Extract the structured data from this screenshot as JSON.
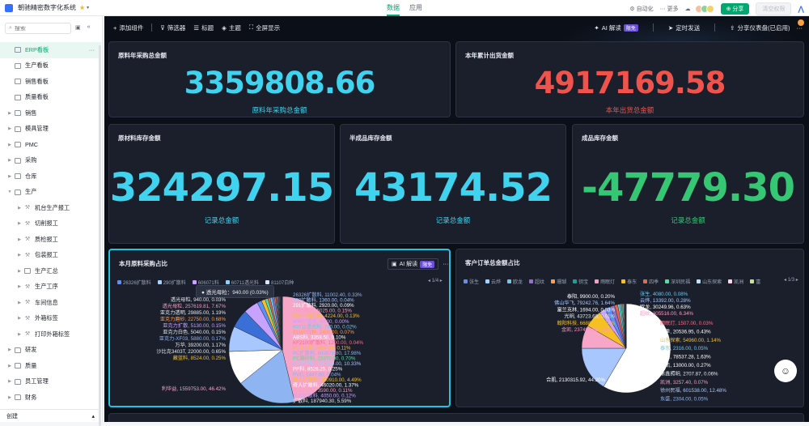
{
  "app": {
    "title": "朝驰精密数字化系统",
    "star": "★",
    "caret": "▾"
  },
  "topnav": {
    "tabs": [
      {
        "label": "数据",
        "active": true
      },
      {
        "label": "应用",
        "active": false
      }
    ]
  },
  "topright": {
    "automation": "自动化",
    "more": "更多",
    "share": "分享",
    "publish": "清空权限"
  },
  "sidebar": {
    "search_placeholder": "搜索",
    "items": [
      {
        "label": "ERP看板",
        "level": 0,
        "type": "board",
        "active": true,
        "arrow": ""
      },
      {
        "label": "生产看板",
        "level": 0,
        "type": "board",
        "arrow": ""
      },
      {
        "label": "销售看板",
        "level": 0,
        "type": "board",
        "arrow": ""
      },
      {
        "label": "质量看板",
        "level": 0,
        "type": "board",
        "arrow": ""
      },
      {
        "label": "销售",
        "level": 0,
        "type": "folder",
        "arrow": "▶"
      },
      {
        "label": "模具管理",
        "level": 0,
        "type": "folder",
        "arrow": "▶"
      },
      {
        "label": "PMC",
        "level": 0,
        "type": "folder",
        "arrow": "▶"
      },
      {
        "label": "采购",
        "level": 0,
        "type": "folder",
        "arrow": "▶"
      },
      {
        "label": "仓库",
        "level": 0,
        "type": "folder",
        "arrow": "▶"
      },
      {
        "label": "生产",
        "level": 0,
        "type": "folder",
        "arrow": "▼"
      },
      {
        "label": "机台生产报工",
        "level": 1,
        "type": "tool",
        "arrow": "▶"
      },
      {
        "label": "切削报工",
        "level": 1,
        "type": "tool",
        "arrow": "▶"
      },
      {
        "label": "质检报工",
        "level": 1,
        "type": "tool",
        "arrow": "▶"
      },
      {
        "label": "包装报工",
        "level": 1,
        "type": "tool",
        "arrow": "▶"
      },
      {
        "label": "生产汇总",
        "level": 1,
        "type": "board",
        "arrow": "▶"
      },
      {
        "label": "生产工序",
        "level": 1,
        "type": "tool",
        "arrow": "▶"
      },
      {
        "label": "车间信息",
        "level": 1,
        "type": "tool",
        "arrow": "▶"
      },
      {
        "label": "外箱标签",
        "level": 1,
        "type": "tool",
        "arrow": "▶"
      },
      {
        "label": "打印外箱标签",
        "level": 1,
        "type": "tool",
        "arrow": "▶"
      },
      {
        "label": "研发",
        "level": 0,
        "type": "folder",
        "arrow": "▶"
      },
      {
        "label": "质量",
        "level": 0,
        "type": "folder",
        "arrow": "▶"
      },
      {
        "label": "员工管理",
        "level": 0,
        "type": "folder",
        "arrow": "▶"
      },
      {
        "label": "财务",
        "level": 0,
        "type": "folder",
        "arrow": "▶"
      }
    ],
    "create_label": "创建"
  },
  "toolbar": {
    "add_component": "添加组件",
    "filter": "筛选器",
    "title": "标题",
    "theme": "主题",
    "fullscreen": "全屏显示",
    "ai_label": "AI 解读",
    "ai_badge": "限免",
    "schedule": "定时发送",
    "share_dashboard": "分享仪表盘(已启用)"
  },
  "cards": {
    "purchase_total": {
      "title": "原料年采购总金额",
      "value": "3359808.66",
      "sub": "原料年采购总金额",
      "color": "#3fd3ef"
    },
    "shipment_total": {
      "title": "本年累计出货金额",
      "value": "4917169.58",
      "sub": "本年出货总金额",
      "color": "#f0534b"
    },
    "raw_inventory": {
      "title": "原材料库存金额",
      "value": "324297.15",
      "sub": "记录总金额",
      "color": "#3fd3ef"
    },
    "semi_inventory": {
      "title": "半成品库存金额",
      "value": "43174.52",
      "sub": "记录总金额",
      "color": "#3fd3ef"
    },
    "finished_inventory": {
      "title": "成品库存金额",
      "value": "-47779.30",
      "sub": "记录总金额",
      "color": "#36c774"
    }
  },
  "pie_left": {
    "title": "本月原料采购占比",
    "ai_label": "AI 解读",
    "ai_badge": "限免",
    "more": "···",
    "legend": [
      "26326扩散料",
      "290扩散料",
      "606071料",
      "60711透光料",
      "81107白种"
    ],
    "legend_colors": [
      "#5b8ff9",
      "#a0d3ff",
      "#c8a2ff",
      "#8fd0ff",
      "#d6e6ff"
    ],
    "pager": "1/4",
    "tooltip": "透光母粒：940.00 (0.03%)",
    "labels": [
      "透光母粒, 940.00, 0.03%",
      "透光母粒, 257619.81, 7.67%",
      "亚克力透明, 29885.00, 1.19%",
      "亚克力磨砂, 22750.00, 0.68%",
      "亚克力扩散, 5130.00, 0.15%",
      "亚克力白色, 5040.00, 0.15%",
      "亚克力-XF03, 5880.00, 0.17%",
      "万华, 39200.00, 1.17%",
      "沙比克3403T, 22000.00, 0.65%",
      "藏蓝料, 8524.00, 0.25%",
      "利华益, 1559753.00, 46.42%",
      "26326扩散料, 11002.40, 0.33%",
      "290扩散料, 1360.00, 0.04%",
      "291扩散料, 2920.00, 0.09%",
      "2980透光, 5025.00, 0.15%",
      "60607透光料, 4224.00, 0.13%",
      "60607透光, 84.00, 0.00%",
      "60711透光料, 730.00, 0.02%",
      "81107白种, 2400.00, 0.07%",
      "ABS料, 3358.50, 0.10%",
      "KF2100扩散料, 1200.00, 0.04%",
      "PCTG 料, 3600.00, 0.11%",
      "PC扩散料, 603978.80, 17.98%",
      "PC磨砂料, 23370.00, 0.70%",
      "PC透明料, 347150.00, 10.33%",
      "PP料, 8526.25, 0.25%",
      "PVC, 1447.60, 0.04%",
      "奇人扩散料, 150910.00, 4.49%",
      "奇人扩散料, 46020.00, 1.37%",
      "奥合PC料, 3590.00, 0.11%",
      "奥合扩散料, 4050.00, 0.12%",
      "扩散料, 187940.30, 5.59%"
    ],
    "chart_data": {
      "type": "pie",
      "title": "本月原料采购占比",
      "slices": [
        {
          "label": "利华益",
          "value": 1559753.0
        },
        {
          "label": "PC扩散料",
          "value": 603978.8
        },
        {
          "label": "PC透明料",
          "value": 347150.0
        },
        {
          "label": "透光母粒",
          "value": 257619.81
        },
        {
          "label": "扩散料",
          "value": 187940.3
        },
        {
          "label": "奇人扩散料",
          "value": 150910.0
        },
        {
          "label": "奇人扩散料",
          "value": 46020.0
        },
        {
          "label": "万华",
          "value": 39200.0
        },
        {
          "label": "亚克力透明",
          "value": 29885.0
        },
        {
          "label": "PC磨砂料",
          "value": 23370.0
        },
        {
          "label": "亚克力磨砂",
          "value": 22750.0
        },
        {
          "label": "沙比克3403T",
          "value": 22000.0
        },
        {
          "label": "26326扩散料",
          "value": 11002.4
        },
        {
          "label": "PP料",
          "value": 8526.25
        },
        {
          "label": "藏蓝料",
          "value": 8524.0
        },
        {
          "label": "亚克力-XF03",
          "value": 5880.0
        },
        {
          "label": "亚克力扩散",
          "value": 5130.0
        },
        {
          "label": "亚克力白色",
          "value": 5040.0
        },
        {
          "label": "2980透光",
          "value": 5025.0
        },
        {
          "label": "60607透光料",
          "value": 4224.0
        },
        {
          "label": "奥合扩散料",
          "value": 4050.0
        },
        {
          "label": "PCTG 料",
          "value": 3600.0
        },
        {
          "label": "奥合PC料",
          "value": 3590.0
        },
        {
          "label": "ABS料",
          "value": 3358.5
        },
        {
          "label": "291扩散料",
          "value": 2920.0
        },
        {
          "label": "81107白种",
          "value": 2400.0
        },
        {
          "label": "PVC",
          "value": 1447.6
        },
        {
          "label": "290扩散料",
          "value": 1360.0
        },
        {
          "label": "KF2100扩散料",
          "value": 1200.0
        },
        {
          "label": "透光母粒",
          "value": 940.0
        },
        {
          "label": "60711透光料",
          "value": 730.0
        },
        {
          "label": "60607透光",
          "value": 84.0
        }
      ]
    }
  },
  "pie_right": {
    "title": "客户订单总金额占比",
    "legend": [
      "张生",
      "云烨",
      "欧龙",
      "超纹",
      "珊瑚",
      "钥宝",
      "雨眠灯",
      "泰东",
      "四季",
      "深圳民福",
      "山东探索",
      "凯洲",
      "富"
    ],
    "legend_colors": [
      "#5b8ff9",
      "#a0d3ff",
      "#6dc8ec",
      "#9270ca",
      "#ff9d4d",
      "#269a99",
      "#ff99c3",
      "#f6c022",
      "#e8684a",
      "#5ad8a6",
      "#b3e5fc",
      "#ffd6e7",
      "#c6e48b"
    ],
    "pager": "1/3",
    "labels": [
      "张生, 4080.00, 0.08%",
      "云烨, 13392.00, 0.28%",
      "欧龙, 30249.96, 0.63%",
      "超纹, 305516.00, 6.34%",
      "泰阳, 9900.00, 0.20%",
      "佛山华飞, 79242.76, 1.64%",
      "富兰克林, 1694.00, 0.03%",
      "光明, 43723.68, 0.91%",
      "翰阳科技, 6688.00, 0.14%",
      "金凯, 237499.50, 4.93%",
      "雨眠灯, 1507.00, 0.03%",
      "四季, 20536.95, 0.43%",
      "山东探索, 54960.00, 1.14%",
      "泰东, 2316.00, 0.05%",
      "铭路, 78537.28, 1.63%",
      "力凯, 13000.00, 0.27%",
      "涂鑫照明, 2707.87, 0.06%",
      "凯洲, 3257.40, 0.07%",
      "徐州民福, 601538.00, 12.48%",
      "东盛, 2304.00, 0.05%",
      "合肌, 2130315.92, 44.20%"
    ],
    "chart_data": {
      "type": "pie",
      "title": "客户订单总金额占比",
      "slices": [
        {
          "label": "合肌",
          "value": 2130315.92
        },
        {
          "label": "徐州民福",
          "value": 601538.0
        },
        {
          "label": "超纹",
          "value": 305516.0
        },
        {
          "label": "金凯",
          "value": 237499.5
        },
        {
          "label": "佛山华飞",
          "value": 79242.76
        },
        {
          "label": "铭路",
          "value": 78537.28
        },
        {
          "label": "山东探索",
          "value": 54960.0
        },
        {
          "label": "光明",
          "value": 43723.68
        },
        {
          "label": "欧龙",
          "value": 30249.96
        },
        {
          "label": "四季",
          "value": 20536.95
        },
        {
          "label": "云烨",
          "value": 13392.0
        },
        {
          "label": "力凯",
          "value": 13000.0
        },
        {
          "label": "泰阳",
          "value": 9900.0
        },
        {
          "label": "翰阳科技",
          "value": 6688.0
        },
        {
          "label": "张生",
          "value": 4080.0
        },
        {
          "label": "凯洲",
          "value": 3257.4
        },
        {
          "label": "涂鑫照明",
          "value": 2707.87
        },
        {
          "label": "泰东",
          "value": 2316.0
        },
        {
          "label": "东盛",
          "value": 2304.0
        },
        {
          "label": "富兰克林",
          "value": 1694.0
        },
        {
          "label": "雨眠灯",
          "value": 1507.0
        }
      ]
    }
  }
}
